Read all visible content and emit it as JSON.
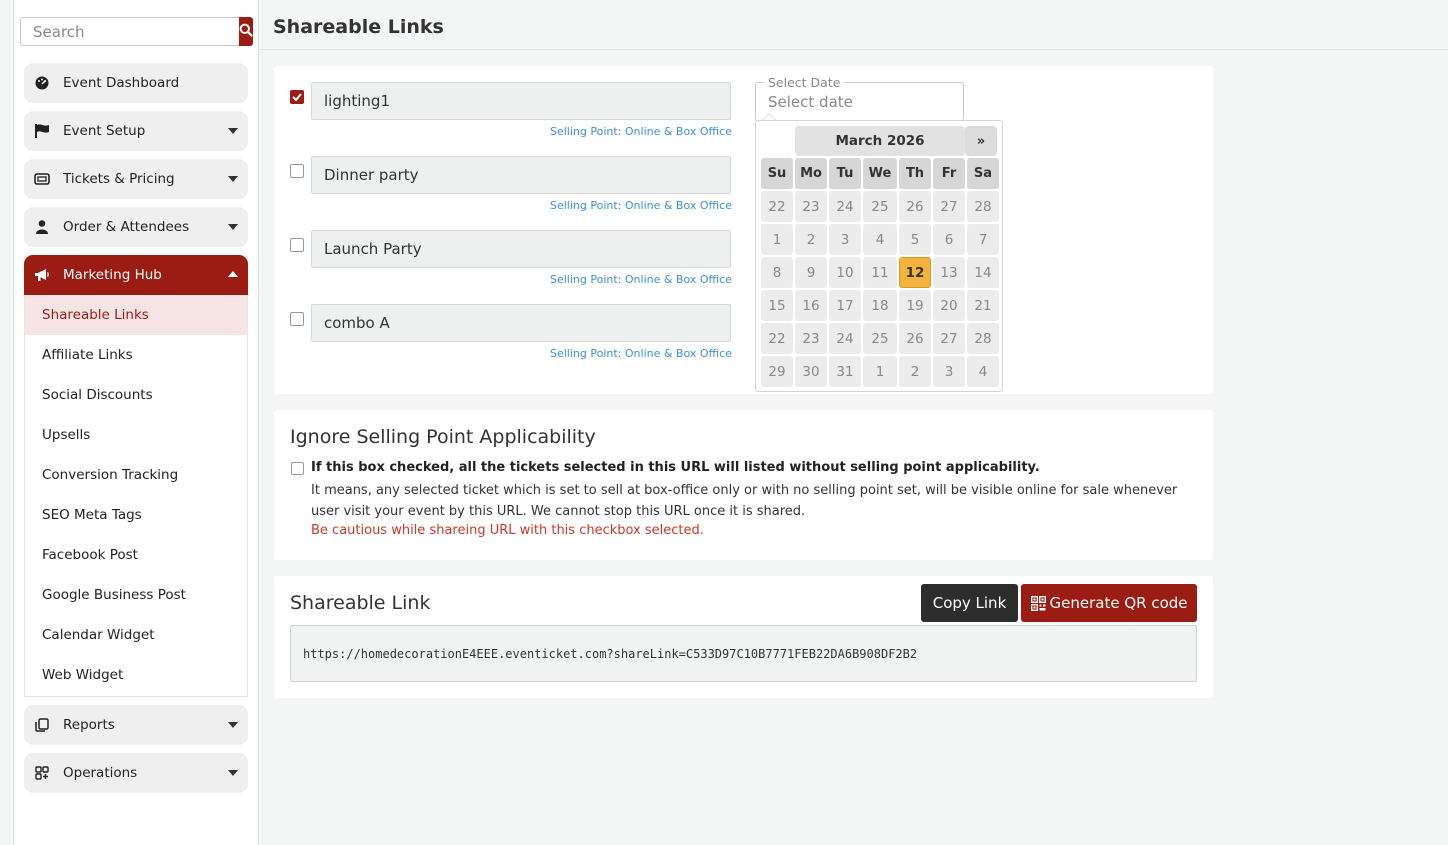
{
  "sidebar": {
    "search_placeholder": "Search",
    "items": [
      {
        "label": "Event Dashboard",
        "icon": "dashboard-icon"
      },
      {
        "label": "Event Setup",
        "icon": "flag-icon"
      },
      {
        "label": "Tickets & Pricing",
        "icon": "ticket-icon"
      },
      {
        "label": "Order & Attendees",
        "icon": "user-icon"
      },
      {
        "label": "Marketing Hub",
        "icon": "megaphone-icon"
      },
      {
        "label": "Reports",
        "icon": "reports-icon"
      },
      {
        "label": "Operations",
        "icon": "operations-icon"
      }
    ],
    "submenu": [
      "Shareable Links",
      "Affiliate Links",
      "Social Discounts",
      "Upsells",
      "Conversion Tracking",
      "SEO Meta Tags",
      "Facebook Post",
      "Google Business Post",
      "Calendar Widget",
      "Web Widget"
    ],
    "active_submenu": "Shareable Links"
  },
  "page": {
    "title": "Shareable Links"
  },
  "tickets": [
    {
      "name": "lighting1",
      "checked": true,
      "selling_point": "Selling Point: Online & Box Office"
    },
    {
      "name": "Dinner party",
      "checked": false,
      "selling_point": "Selling Point: Online & Box Office"
    },
    {
      "name": "Launch Party",
      "checked": false,
      "selling_point": "Selling Point: Online & Box Office"
    },
    {
      "name": "combo A",
      "checked": false,
      "selling_point": "Selling Point: Online & Box Office"
    }
  ],
  "date_picker": {
    "legend": "Select Date",
    "placeholder": "Select date",
    "month_label": "March 2026",
    "next_label": "»",
    "weekdays": [
      "Su",
      "Mo",
      "Tu",
      "We",
      "Th",
      "Fr",
      "Sa"
    ],
    "days": [
      "22",
      "23",
      "24",
      "25",
      "26",
      "27",
      "28",
      "1",
      "2",
      "3",
      "4",
      "5",
      "6",
      "7",
      "8",
      "9",
      "10",
      "11",
      "12",
      "13",
      "14",
      "15",
      "16",
      "17",
      "18",
      "19",
      "20",
      "21",
      "22",
      "23",
      "24",
      "25",
      "26",
      "27",
      "28",
      "29",
      "30",
      "31",
      "1",
      "2",
      "3",
      "4"
    ],
    "today": "12"
  },
  "ignore_section": {
    "heading": "Ignore Selling Point Applicability",
    "checkbox_label": "If this box checked, all the tickets selected in this URL will listed without selling point applicability.",
    "description": "It means, any selected ticket which is set to sell at box-office only or with no selling point set, will be visible online for sale whenever user visit your event by this URL. We cannot stop this URL once it is shared.",
    "warning": "Be cautious while shareing URL with this checkbox selected."
  },
  "share_section": {
    "heading": "Shareable Link",
    "copy_label": "Copy Link",
    "qr_label": "Generate QR code",
    "url": "https://homedecorationE4EEE.eventicket.com?shareLink=C533D97C10B7771FEB22DA6B908DF2B2"
  },
  "colors": {
    "brand": "#9b1c12",
    "link_blue": "#3b8fd8",
    "today": "#f3b33d",
    "warning": "#c8382b"
  }
}
